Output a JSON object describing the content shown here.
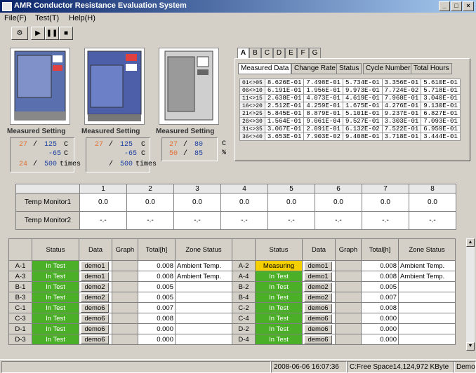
{
  "window": {
    "title": "AMR Conductor Resistance Evaluation System"
  },
  "menu": [
    "File(F)",
    "Test(T)",
    "Help(H)"
  ],
  "chambers": [
    {
      "header": "Measured Setting",
      "rows": [
        {
          "measured": "27",
          "setting": "125",
          "unit": "C"
        },
        {
          "measured": "",
          "setting": "-65",
          "unit": "C"
        },
        {
          "measured": "24",
          "setting": "500",
          "unit": "times"
        }
      ]
    },
    {
      "header": "Measured Setting",
      "rows": [
        {
          "measured": "27",
          "setting": "125",
          "unit": "C"
        },
        {
          "measured": "",
          "setting": "-65",
          "unit": "C"
        },
        {
          "measured": "",
          "setting": "500",
          "unit": "times"
        }
      ]
    },
    {
      "header": "Measured Setting",
      "rows": [
        {
          "measured": "27",
          "setting": "80",
          "unit": "C"
        },
        {
          "measured": "50",
          "setting": "85",
          "unit": "%"
        }
      ]
    }
  ],
  "letter_tabs": [
    "A",
    "B",
    "C",
    "D",
    "E",
    "F",
    "G"
  ],
  "sub_tabs": [
    "Measured Data",
    "Change Rate",
    "Status",
    "Cycle Number",
    "Total Hours"
  ],
  "measured_data": [
    [
      "01<>05",
      "8.626E-01",
      "7.498E-01",
      "5.734E-01",
      "3.356E-01",
      "5.610E-01"
    ],
    [
      "06<>10",
      "6.191E-01",
      "1.956E-01",
      "9.973E-01",
      "7.724E-02",
      "5.718E-01"
    ],
    [
      "11<>15",
      "2.638E-01",
      "4.073E-01",
      "4.619E-01",
      "7.968E-01",
      "3.040E-01"
    ],
    [
      "16<>20",
      "2.512E-01",
      "4.259E-01",
      "1.675E-01",
      "4.276E-01",
      "9.130E-01"
    ],
    [
      "21<>25",
      "5.845E-01",
      "8.879E-01",
      "5.101E-01",
      "9.237E-01",
      "6.827E-01"
    ],
    [
      "26<>30",
      "1.564E-01",
      "9.061E-04",
      "9.527E-01",
      "3.303E-01",
      "7.093E-01"
    ],
    [
      "31<>35",
      "3.067E-01",
      "2.091E-01",
      "6.132E-02",
      "7.522E-01",
      "6.959E-01"
    ],
    [
      "36<>40",
      "3.653E-01",
      "7.903E-02",
      "9.408E-01",
      "3.718E-01",
      "3.444E-01"
    ]
  ],
  "temp_monitor": {
    "columns": [
      "1",
      "2",
      "3",
      "4",
      "5",
      "6",
      "7",
      "8"
    ],
    "rows": [
      {
        "label": "Temp Monitor1",
        "values": [
          "0.0",
          "0.0",
          "0.0",
          "0.0",
          "0.0",
          "0.0",
          "0.0",
          "0.0"
        ]
      },
      {
        "label": "Temp Monitor2",
        "values": [
          "-.-",
          "-.-",
          "-.-",
          "-.-",
          "-.-",
          "-.-",
          "-.-",
          "-.-"
        ]
      }
    ]
  },
  "grid_headers": [
    "Status",
    "Data",
    "Graph",
    "Total[h]",
    "Zone Status"
  ],
  "grid": [
    {
      "l": {
        "id": "A-1",
        "status": "In Test",
        "data": "demo1",
        "total": "0.008",
        "zone": "Ambient Temp."
      },
      "r": {
        "id": "A-2",
        "status": "Measuring",
        "data": "demo1",
        "total": "0.008",
        "zone": "Ambient Temp."
      }
    },
    {
      "l": {
        "id": "A-3",
        "status": "In Test",
        "data": "demo1",
        "total": "0.008",
        "zone": "Ambient Temp."
      },
      "r": {
        "id": "A-4",
        "status": "In Test",
        "data": "demo1",
        "total": "0.008",
        "zone": "Ambient Temp."
      }
    },
    {
      "l": {
        "id": "B-1",
        "status": "In Test",
        "data": "demo2",
        "total": "0.005",
        "zone": ""
      },
      "r": {
        "id": "B-2",
        "status": "In Test",
        "data": "demo2",
        "total": "0.005",
        "zone": ""
      }
    },
    {
      "l": {
        "id": "B-3",
        "status": "In Test",
        "data": "demo2",
        "total": "0.005",
        "zone": ""
      },
      "r": {
        "id": "B-4",
        "status": "In Test",
        "data": "demo2",
        "total": "0.007",
        "zone": ""
      }
    },
    {
      "l": {
        "id": "C-1",
        "status": "In Test",
        "data": "demo6",
        "total": "0.007",
        "zone": ""
      },
      "r": {
        "id": "C-2",
        "status": "In Test",
        "data": "demo6",
        "total": "0.008",
        "zone": ""
      }
    },
    {
      "l": {
        "id": "C-3",
        "status": "In Test",
        "data": "demo6",
        "total": "0.008",
        "zone": ""
      },
      "r": {
        "id": "C-4",
        "status": "In Test",
        "data": "demo6",
        "total": "0.000",
        "zone": ""
      }
    },
    {
      "l": {
        "id": "D-1",
        "status": "In Test",
        "data": "demo6",
        "total": "0.000",
        "zone": ""
      },
      "r": {
        "id": "D-2",
        "status": "In Test",
        "data": "demo6",
        "total": "0.000",
        "zone": ""
      }
    },
    {
      "l": {
        "id": "D-3",
        "status": "In Test",
        "data": "demo6",
        "total": "0.000",
        "zone": ""
      },
      "r": {
        "id": "D-4",
        "status": "In Test",
        "data": "demo6",
        "total": "0.000",
        "zone": ""
      }
    }
  ],
  "statusbar": {
    "datetime": "2008-06-06 16:07:36",
    "free_space": "C:Free Space14,124,972 KByte",
    "mode": "Demo"
  },
  "colors": {
    "in_test": "#4caf28",
    "measuring": "#f5d000",
    "measured_text": "#e07030",
    "setting_text": "#1a3fa0"
  }
}
